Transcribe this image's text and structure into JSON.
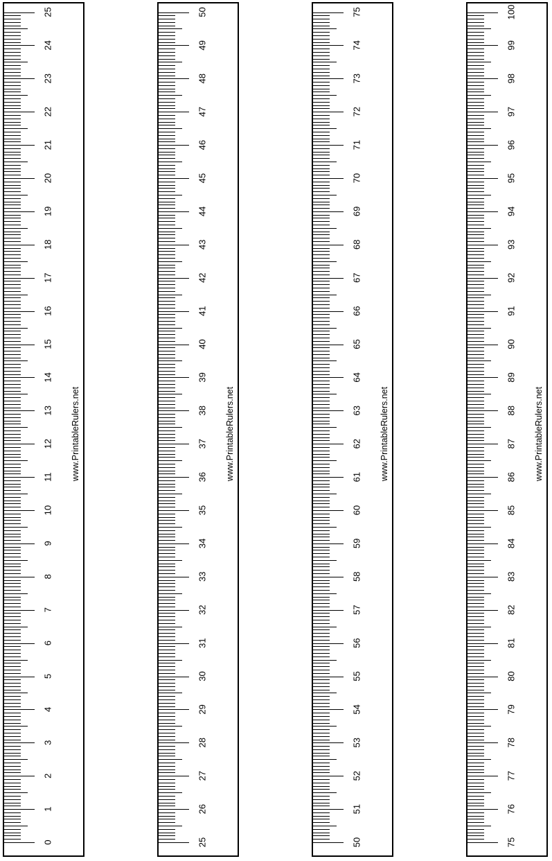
{
  "site_label": "www.PrintableRulers.net",
  "rulers": [
    {
      "start": 0,
      "end": 25,
      "labels": [
        "0",
        "1",
        "2",
        "3",
        "4",
        "5",
        "6",
        "7",
        "8",
        "9",
        "10",
        "11",
        "12",
        "13",
        "14",
        "15",
        "16",
        "17",
        "18",
        "19",
        "20",
        "21",
        "22",
        "23",
        "24",
        "25"
      ]
    },
    {
      "start": 25,
      "end": 50,
      "labels": [
        "25",
        "26",
        "27",
        "28",
        "29",
        "30",
        "31",
        "32",
        "33",
        "34",
        "35",
        "36",
        "37",
        "38",
        "39",
        "40",
        "41",
        "42",
        "43",
        "44",
        "45",
        "46",
        "47",
        "48",
        "49",
        "50"
      ]
    },
    {
      "start": 50,
      "end": 75,
      "labels": [
        "50",
        "51",
        "52",
        "53",
        "54",
        "55",
        "56",
        "57",
        "58",
        "59",
        "60",
        "61",
        "62",
        "63",
        "64",
        "65",
        "66",
        "67",
        "68",
        "69",
        "70",
        "71",
        "72",
        "73",
        "74",
        "75"
      ]
    },
    {
      "start": 75,
      "end": 100,
      "labels": [
        "75",
        "76",
        "77",
        "78",
        "79",
        "80",
        "81",
        "82",
        "83",
        "84",
        "85",
        "86",
        "87",
        "88",
        "89",
        "90",
        "91",
        "92",
        "93",
        "94",
        "95",
        "96",
        "97",
        "98",
        "99",
        "100"
      ]
    }
  ]
}
